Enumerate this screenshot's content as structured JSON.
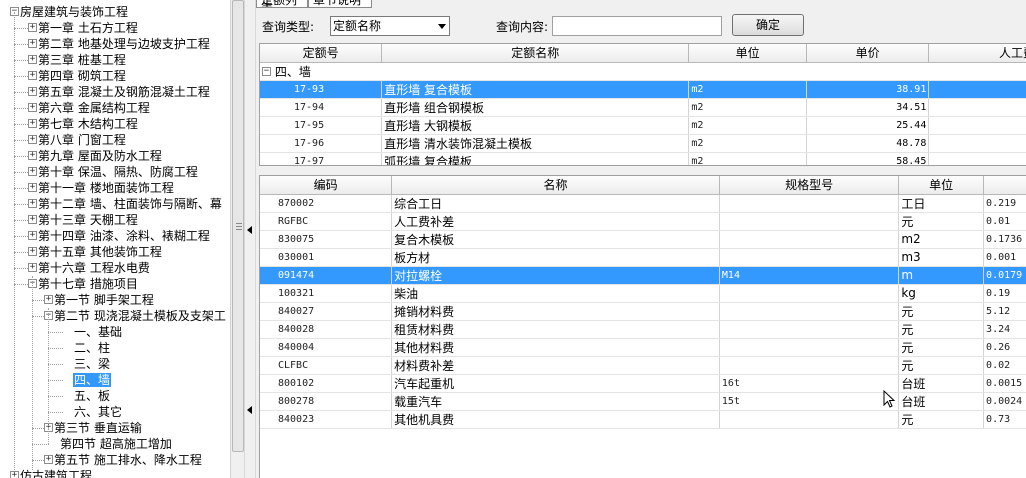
{
  "tree": {
    "items": [
      {
        "label": "房屋建筑与装饰工程",
        "level": 0,
        "expander": "−"
      },
      {
        "label": "第一章 土石方工程",
        "level": 1,
        "expander": "+"
      },
      {
        "label": "第二章 地基处理与边坡支护工程",
        "level": 1,
        "expander": "+"
      },
      {
        "label": "第三章 桩基工程",
        "level": 1,
        "expander": "+"
      },
      {
        "label": "第四章 砌筑工程",
        "level": 1,
        "expander": "+"
      },
      {
        "label": "第五章 混凝土及钢筋混凝土工程",
        "level": 1,
        "expander": "+"
      },
      {
        "label": "第六章 金属结构工程",
        "level": 1,
        "expander": "+"
      },
      {
        "label": "第七章 木结构工程",
        "level": 1,
        "expander": "+"
      },
      {
        "label": "第八章 门窗工程",
        "level": 1,
        "expander": "+"
      },
      {
        "label": "第九章 屋面及防水工程",
        "level": 1,
        "expander": "+"
      },
      {
        "label": "第十章 保温、隔热、防腐工程",
        "level": 1,
        "expander": "+"
      },
      {
        "label": "第十一章 楼地面装饰工程",
        "level": 1,
        "expander": "+"
      },
      {
        "label": "第十二章 墙、柱面装饰与隔断、幕",
        "level": 1,
        "expander": "+"
      },
      {
        "label": "第十三章 天棚工程",
        "level": 1,
        "expander": "+"
      },
      {
        "label": "第十四章 油漆、涂料、裱糊工程",
        "level": 1,
        "expander": "+"
      },
      {
        "label": "第十五章 其他装饰工程",
        "level": 1,
        "expander": "+"
      },
      {
        "label": "第十六章 工程水电费",
        "level": 1,
        "expander": "+"
      },
      {
        "label": "第十七章 措施项目",
        "level": 1,
        "expander": "−"
      },
      {
        "label": "第一节 脚手架工程",
        "level": 2,
        "expander": "+"
      },
      {
        "label": "第二节 现浇混凝土模板及支架工",
        "level": 2,
        "expander": "−"
      },
      {
        "label": "一、基础",
        "level": 3,
        "expander": ""
      },
      {
        "label": "二、柱",
        "level": 3,
        "expander": ""
      },
      {
        "label": "三、梁",
        "level": 3,
        "expander": ""
      },
      {
        "label": "四、墙",
        "level": 3,
        "expander": "",
        "selected": true
      },
      {
        "label": "五、板",
        "level": 3,
        "expander": ""
      },
      {
        "label": "六、其它",
        "level": 3,
        "expander": ""
      },
      {
        "label": "第三节 垂直运输",
        "level": 2,
        "expander": "+"
      },
      {
        "label": "第四节 超高施工增加",
        "level": 2,
        "expander": ""
      },
      {
        "label": "第五节 施工排水、降水工程",
        "level": 2,
        "expander": "+"
      },
      {
        "label": "仿古建筑工程",
        "level": 0,
        "expander": "+"
      }
    ]
  },
  "tabs": [
    "定额列表",
    "章节说明"
  ],
  "query": {
    "type_label": "查询类型:",
    "type_value": "定额名称",
    "content_label": "查询内容:",
    "content_value": "",
    "confirm_label": "确定"
  },
  "quota_table": {
    "columns": [
      "定额号",
      "定额名称",
      "单位",
      "单价",
      "人工费"
    ],
    "group": {
      "expander": "−",
      "label": "四、墙"
    },
    "rows": [
      {
        "code": "17-93",
        "name": "直形墙 复合模板",
        "unit": "m2",
        "price": "38.91",
        "selected": true
      },
      {
        "code": "17-94",
        "name": "直形墙 组合钢模板",
        "unit": "m2",
        "price": "34.51"
      },
      {
        "code": "17-95",
        "name": "直形墙 大钢模板",
        "unit": "m2",
        "price": "25.44"
      },
      {
        "code": "17-96",
        "name": "直形墙 清水装饰混凝土模板",
        "unit": "m2",
        "price": "48.78"
      },
      {
        "code": "17-97",
        "name": "弧形墙 复合模板",
        "unit": "m2",
        "price": "58.45"
      }
    ]
  },
  "resource_table": {
    "columns": [
      "编码",
      "名称",
      "规格型号",
      "单位",
      ""
    ],
    "rows": [
      {
        "code": "870002",
        "name": "综合工日",
        "spec": "",
        "unit": "工日",
        "qty": "0.219"
      },
      {
        "code": "RGFBC",
        "name": "人工费补差",
        "spec": "",
        "unit": "元",
        "qty": "0.01"
      },
      {
        "code": "830075",
        "name": "复合木模板",
        "spec": "",
        "unit": "m2",
        "qty": "0.1736"
      },
      {
        "code": "030001",
        "name": "板方材",
        "spec": "",
        "unit": "m3",
        "qty": "0.001"
      },
      {
        "code": "091474",
        "name": "对拉螺栓",
        "spec": "M14",
        "unit": "m",
        "qty": "0.0179",
        "selected": true
      },
      {
        "code": "100321",
        "name": "柴油",
        "spec": "",
        "unit": "kg",
        "qty": "0.19"
      },
      {
        "code": "840027",
        "name": "摊销材料费",
        "spec": "",
        "unit": "元",
        "qty": "5.12"
      },
      {
        "code": "840028",
        "name": "租赁材料费",
        "spec": "",
        "unit": "元",
        "qty": "3.24"
      },
      {
        "code": "840004",
        "name": "其他材料费",
        "spec": "",
        "unit": "元",
        "qty": "0.26"
      },
      {
        "code": "CLFBC",
        "name": "材料费补差",
        "spec": "",
        "unit": "元",
        "qty": "0.02"
      },
      {
        "code": "800102",
        "name": "汽车起重机",
        "spec": "16t",
        "unit": "台班",
        "qty": "0.0015"
      },
      {
        "code": "800278",
        "name": "载重汽车",
        "spec": "15t",
        "unit": "台班",
        "qty": "0.0024"
      },
      {
        "code": "840023",
        "name": "其他机具费",
        "spec": "",
        "unit": "元",
        "qty": "0.73"
      }
    ]
  },
  "colors": {
    "selection": "#3399ff",
    "header_bg": "#ececec"
  }
}
